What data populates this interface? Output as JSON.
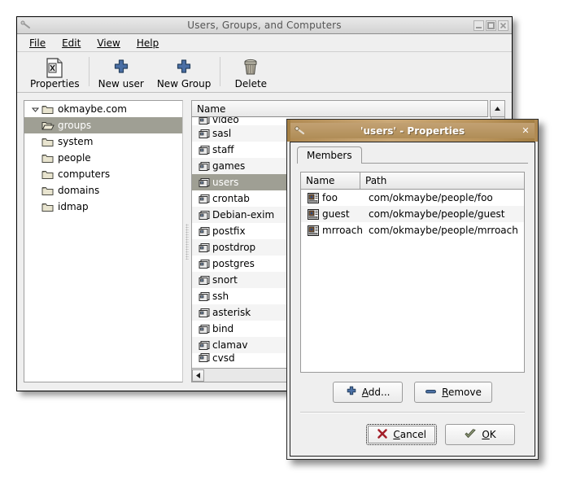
{
  "main_window": {
    "title": "Users, Groups, and Computers",
    "window_buttons": [
      "minimize",
      "maximize",
      "close"
    ],
    "menu": [
      {
        "label": "File",
        "mnemonic": "F"
      },
      {
        "label": "Edit",
        "mnemonic": "E"
      },
      {
        "label": "View",
        "mnemonic": "V"
      },
      {
        "label": "Help",
        "mnemonic": "H"
      }
    ],
    "toolbar": [
      {
        "label": "Properties",
        "icon": "properties-icon"
      },
      {
        "label": "New user",
        "icon": "plus-icon"
      },
      {
        "label": "New Group",
        "icon": "plus-icon"
      },
      {
        "label": "Delete",
        "icon": "trash-icon"
      }
    ],
    "tree": {
      "root": {
        "label": "okmaybe.com",
        "icon": "folder-icon",
        "expanded": true
      },
      "items": [
        {
          "label": "groups",
          "icon": "folder-open-icon",
          "selected": true
        },
        {
          "label": "system",
          "icon": "folder-icon",
          "selected": false
        },
        {
          "label": "people",
          "icon": "folder-icon",
          "selected": false
        },
        {
          "label": "computers",
          "icon": "folder-icon",
          "selected": false
        },
        {
          "label": "domains",
          "icon": "folder-icon",
          "selected": false
        },
        {
          "label": "idmap",
          "icon": "folder-icon",
          "selected": false
        }
      ]
    },
    "list": {
      "column_header": "Name",
      "rows": [
        {
          "label": "video",
          "selected": false,
          "clipped": true
        },
        {
          "label": "sasl",
          "selected": false
        },
        {
          "label": "staff",
          "selected": false
        },
        {
          "label": "games",
          "selected": false
        },
        {
          "label": "users",
          "selected": true
        },
        {
          "label": "crontab",
          "selected": false
        },
        {
          "label": "Debian-exim",
          "selected": false
        },
        {
          "label": "postfix",
          "selected": false
        },
        {
          "label": "postdrop",
          "selected": false
        },
        {
          "label": "postgres",
          "selected": false
        },
        {
          "label": "snort",
          "selected": false
        },
        {
          "label": "ssh",
          "selected": false
        },
        {
          "label": "asterisk",
          "selected": false
        },
        {
          "label": "bind",
          "selected": false
        },
        {
          "label": "clamav",
          "selected": false
        },
        {
          "label": "cvsd",
          "selected": false,
          "clipped": true
        }
      ]
    }
  },
  "props_dialog": {
    "title": "'users' - Properties",
    "close_label": "✕",
    "tabs": [
      {
        "label": "Members",
        "active": true
      }
    ],
    "members_table": {
      "columns": [
        "Name",
        "Path"
      ],
      "rows": [
        {
          "name": "foo",
          "path": "com/okmaybe/people/foo"
        },
        {
          "name": "guest",
          "path": "com/okmaybe/people/guest"
        },
        {
          "name": "mrroach",
          "path": "com/okmaybe/people/mrroach"
        }
      ]
    },
    "list_buttons": [
      {
        "label": "Add...",
        "mnemonic": "A",
        "icon": "plus-icon"
      },
      {
        "label": "Remove",
        "mnemonic": "R",
        "icon": "minus-icon"
      }
    ],
    "action_buttons": [
      {
        "label": "Cancel",
        "mnemonic": "C",
        "icon": "cancel-x-icon",
        "default": true
      },
      {
        "label": "OK",
        "mnemonic": "O",
        "icon": "ok-check-icon",
        "default": false
      }
    ]
  },
  "colors": {
    "selection": "#9f9f94",
    "dialog_titlebar": "#b08d57",
    "window_bg": "#efefef",
    "accent_blue": "#3b6ea5"
  }
}
